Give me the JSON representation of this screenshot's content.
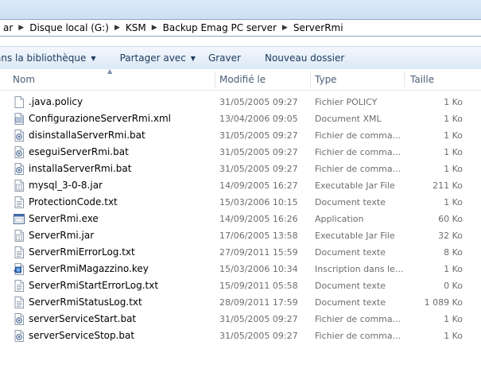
{
  "address": {
    "segments": [
      "ar",
      "Disque local (G:)",
      "KSM",
      "Backup Emag PC server",
      "ServerRmi"
    ]
  },
  "toolbar": {
    "library_label": "ans la bibliothèque",
    "share_label": "Partager avec",
    "burn_label": "Graver",
    "new_folder_label": "Nouveau dossier"
  },
  "columns": {
    "name": "Nom",
    "modified": "Modifié le",
    "type": "Type",
    "size": "Taille"
  },
  "files": [
    {
      "name": ".java.policy",
      "modified": "31/05/2005 09:27",
      "type": "Fichier POLICY",
      "size": "1 Ko",
      "icon": "document-icon"
    },
    {
      "name": "ConfigurazioneServerRmi.xml",
      "modified": "13/04/2006 09:05",
      "type": "Document XML",
      "size": "1 Ko",
      "icon": "xml-file-icon"
    },
    {
      "name": "disinstallaServerRmi.bat",
      "modified": "31/05/2005 09:27",
      "type": "Fichier de comma...",
      "size": "1 Ko",
      "icon": "batch-file-icon"
    },
    {
      "name": "eseguiServerRmi.bat",
      "modified": "31/05/2005 09:27",
      "type": "Fichier de comma...",
      "size": "1 Ko",
      "icon": "batch-file-icon"
    },
    {
      "name": "installaServerRmi.bat",
      "modified": "31/05/2005 09:27",
      "type": "Fichier de comma...",
      "size": "1 Ko",
      "icon": "batch-file-icon"
    },
    {
      "name": "mysql_3-0-8.jar",
      "modified": "14/09/2005 16:27",
      "type": "Executable Jar File",
      "size": "211 Ko",
      "icon": "jar-file-icon"
    },
    {
      "name": "ProtectionCode.txt",
      "modified": "15/03/2006 10:15",
      "type": "Document texte",
      "size": "1 Ko",
      "icon": "text-file-icon"
    },
    {
      "name": "ServerRmi.exe",
      "modified": "14/09/2005 16:26",
      "type": "Application",
      "size": "60 Ko",
      "icon": "application-icon"
    },
    {
      "name": "ServerRmi.jar",
      "modified": "17/06/2005 13:58",
      "type": "Executable Jar File",
      "size": "32 Ko",
      "icon": "jar-file-icon"
    },
    {
      "name": "ServerRmiErrorLog.txt",
      "modified": "27/09/2011 15:59",
      "type": "Document texte",
      "size": "8 Ko",
      "icon": "text-file-icon"
    },
    {
      "name": "ServerRmiMagazzino.key",
      "modified": "15/03/2006 10:34",
      "type": "Inscription dans le...",
      "size": "1 Ko",
      "icon": "registry-file-icon"
    },
    {
      "name": "ServerRmiStartErrorLog.txt",
      "modified": "15/09/2011 05:58",
      "type": "Document texte",
      "size": "0 Ko",
      "icon": "text-file-icon"
    },
    {
      "name": "ServerRmiStatusLog.txt",
      "modified": "28/09/2011 17:59",
      "type": "Document texte",
      "size": "1 089 Ko",
      "icon": "text-file-icon"
    },
    {
      "name": "serverServiceStart.bat",
      "modified": "31/05/2005 09:27",
      "type": "Fichier de comma...",
      "size": "1 Ko",
      "icon": "batch-file-icon"
    },
    {
      "name": "serverServiceStop.bat",
      "modified": "31/05/2005 09:27",
      "type": "Fichier de comma...",
      "size": "1 Ko",
      "icon": "batch-file-icon"
    }
  ]
}
